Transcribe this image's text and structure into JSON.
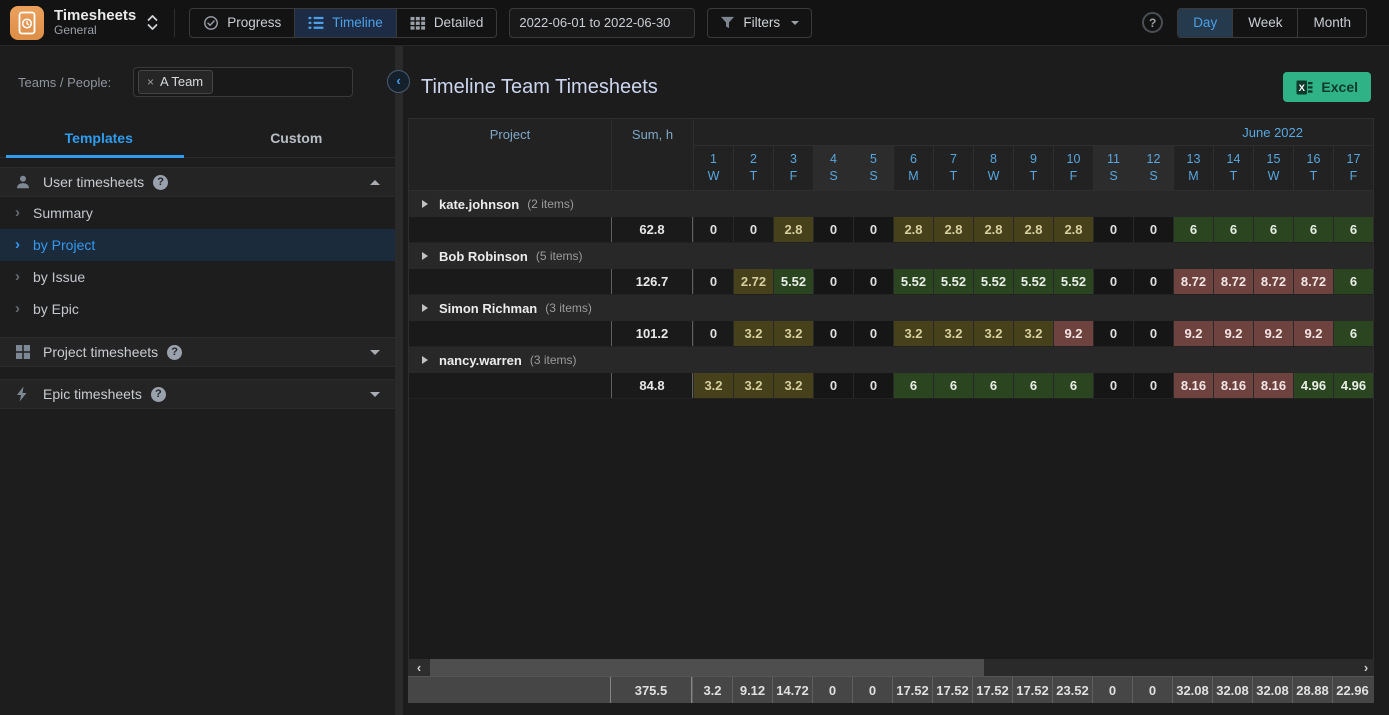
{
  "colors": {
    "accent_blue": "#3b9be8",
    "excel_green": "#2fb286",
    "cell_olive": "#46401b",
    "cell_green": "#2a4520",
    "cell_red": "#6e423e"
  },
  "topbar": {
    "app_title": "Timesheets",
    "app_subtitle": "General",
    "views": [
      {
        "label": "Progress",
        "icon": "progress-check-icon",
        "active": false
      },
      {
        "label": "Timeline",
        "icon": "timeline-list-icon",
        "active": true
      },
      {
        "label": "Detailed",
        "icon": "detailed-grid-icon",
        "active": false
      }
    ],
    "date_range_value": "2022-06-01 to 2022-06-30",
    "filters_label": "Filters",
    "help_label": "?",
    "zoom_levels": [
      {
        "label": "Day",
        "active": true
      },
      {
        "label": "Week",
        "active": false
      },
      {
        "label": "Month",
        "active": false
      }
    ]
  },
  "sidebar": {
    "teams_label": "Teams / People:",
    "team_tag_label": "A Team",
    "tabs": [
      {
        "label": "Templates",
        "active": true
      },
      {
        "label": "Custom",
        "active": false
      }
    ],
    "sections": [
      {
        "label": "User timesheets",
        "icon": "user-icon",
        "expanded": true,
        "items": [
          {
            "label": "Summary",
            "selected": false
          },
          {
            "label": "by Project",
            "selected": true
          },
          {
            "label": "by Issue",
            "selected": false
          },
          {
            "label": "by Epic",
            "selected": false
          }
        ]
      },
      {
        "label": "Project timesheets",
        "icon": "grid-icon",
        "expanded": false,
        "items": []
      },
      {
        "label": "Epic timesheets",
        "icon": "bolt-icon",
        "expanded": false,
        "items": []
      }
    ]
  },
  "main": {
    "title": "Timeline Team Timesheets",
    "excel_button_label": "Excel",
    "table": {
      "project_header": "Project",
      "sum_header": "Sum, h",
      "month_label": "June 2022",
      "days": [
        {
          "num": "1",
          "dow": "W",
          "weekend": false
        },
        {
          "num": "2",
          "dow": "T",
          "weekend": false
        },
        {
          "num": "3",
          "dow": "F",
          "weekend": false
        },
        {
          "num": "4",
          "dow": "S",
          "weekend": true
        },
        {
          "num": "5",
          "dow": "S",
          "weekend": true
        },
        {
          "num": "6",
          "dow": "M",
          "weekend": false
        },
        {
          "num": "7",
          "dow": "T",
          "weekend": false
        },
        {
          "num": "8",
          "dow": "W",
          "weekend": false
        },
        {
          "num": "9",
          "dow": "T",
          "weekend": false
        },
        {
          "num": "10",
          "dow": "F",
          "weekend": false
        },
        {
          "num": "11",
          "dow": "S",
          "weekend": true
        },
        {
          "num": "12",
          "dow": "S",
          "weekend": true
        },
        {
          "num": "13",
          "dow": "M",
          "weekend": false
        },
        {
          "num": "14",
          "dow": "T",
          "weekend": false
        },
        {
          "num": "15",
          "dow": "W",
          "weekend": false
        },
        {
          "num": "16",
          "dow": "T",
          "weekend": false
        },
        {
          "num": "17",
          "dow": "F",
          "weekend": false
        }
      ],
      "groups": [
        {
          "name": "kate.johnson",
          "items_label": "(2 items)",
          "sum": "62.8",
          "cells": [
            {
              "v": "0",
              "color": "none"
            },
            {
              "v": "0",
              "color": "none"
            },
            {
              "v": "2.8",
              "color": "olive"
            },
            {
              "v": "0",
              "color": "none"
            },
            {
              "v": "0",
              "color": "none"
            },
            {
              "v": "2.8",
              "color": "olive"
            },
            {
              "v": "2.8",
              "color": "olive"
            },
            {
              "v": "2.8",
              "color": "olive"
            },
            {
              "v": "2.8",
              "color": "olive"
            },
            {
              "v": "2.8",
              "color": "olive"
            },
            {
              "v": "0",
              "color": "none"
            },
            {
              "v": "0",
              "color": "none"
            },
            {
              "v": "6",
              "color": "green"
            },
            {
              "v": "6",
              "color": "green"
            },
            {
              "v": "6",
              "color": "green"
            },
            {
              "v": "6",
              "color": "green"
            },
            {
              "v": "6",
              "color": "green"
            }
          ]
        },
        {
          "name": "Bob Robinson",
          "items_label": "(5 items)",
          "sum": "126.7",
          "cells": [
            {
              "v": "0",
              "color": "none"
            },
            {
              "v": "2.72",
              "color": "olive"
            },
            {
              "v": "5.52",
              "color": "green"
            },
            {
              "v": "0",
              "color": "none"
            },
            {
              "v": "0",
              "color": "none"
            },
            {
              "v": "5.52",
              "color": "green"
            },
            {
              "v": "5.52",
              "color": "green"
            },
            {
              "v": "5.52",
              "color": "green"
            },
            {
              "v": "5.52",
              "color": "green"
            },
            {
              "v": "5.52",
              "color": "green"
            },
            {
              "v": "0",
              "color": "none"
            },
            {
              "v": "0",
              "color": "none"
            },
            {
              "v": "8.72",
              "color": "red"
            },
            {
              "v": "8.72",
              "color": "red"
            },
            {
              "v": "8.72",
              "color": "red"
            },
            {
              "v": "8.72",
              "color": "red"
            },
            {
              "v": "6",
              "color": "green"
            }
          ]
        },
        {
          "name": "Simon Richman",
          "items_label": "(3 items)",
          "sum": "101.2",
          "cells": [
            {
              "v": "0",
              "color": "none"
            },
            {
              "v": "3.2",
              "color": "olive"
            },
            {
              "v": "3.2",
              "color": "olive"
            },
            {
              "v": "0",
              "color": "none"
            },
            {
              "v": "0",
              "color": "none"
            },
            {
              "v": "3.2",
              "color": "olive"
            },
            {
              "v": "3.2",
              "color": "olive"
            },
            {
              "v": "3.2",
              "color": "olive"
            },
            {
              "v": "3.2",
              "color": "olive"
            },
            {
              "v": "9.2",
              "color": "red"
            },
            {
              "v": "0",
              "color": "none"
            },
            {
              "v": "0",
              "color": "none"
            },
            {
              "v": "9.2",
              "color": "red"
            },
            {
              "v": "9.2",
              "color": "red"
            },
            {
              "v": "9.2",
              "color": "red"
            },
            {
              "v": "9.2",
              "color": "red"
            },
            {
              "v": "6",
              "color": "green"
            }
          ]
        },
        {
          "name": "nancy.warren",
          "items_label": "(3 items)",
          "sum": "84.8",
          "cells": [
            {
              "v": "3.2",
              "color": "olive"
            },
            {
              "v": "3.2",
              "color": "olive"
            },
            {
              "v": "3.2",
              "color": "olive"
            },
            {
              "v": "0",
              "color": "none"
            },
            {
              "v": "0",
              "color": "none"
            },
            {
              "v": "6",
              "color": "green"
            },
            {
              "v": "6",
              "color": "green"
            },
            {
              "v": "6",
              "color": "green"
            },
            {
              "v": "6",
              "color": "green"
            },
            {
              "v": "6",
              "color": "green"
            },
            {
              "v": "0",
              "color": "none"
            },
            {
              "v": "0",
              "color": "none"
            },
            {
              "v": "8.16",
              "color": "red"
            },
            {
              "v": "8.16",
              "color": "red"
            },
            {
              "v": "8.16",
              "color": "red"
            },
            {
              "v": "4.96",
              "color": "green"
            },
            {
              "v": "4.96",
              "color": "green"
            }
          ]
        }
      ],
      "totals": {
        "sum": "375.5",
        "cells": [
          "3.2",
          "9.12",
          "14.72",
          "0",
          "0",
          "17.52",
          "17.52",
          "17.52",
          "17.52",
          "23.52",
          "0",
          "0",
          "32.08",
          "32.08",
          "32.08",
          "28.88",
          "22.96"
        ]
      }
    }
  }
}
